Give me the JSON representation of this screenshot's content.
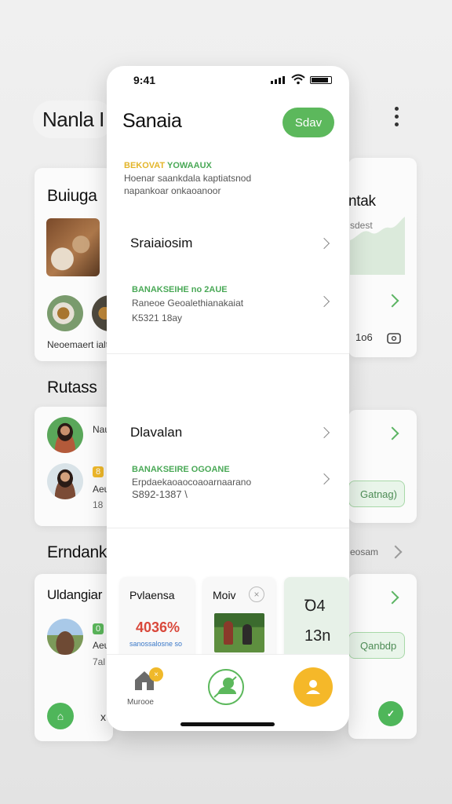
{
  "background": {
    "title": "Nanla I",
    "sections": {
      "s1": "Buiuga",
      "s2": "Rutass",
      "s3": "Erndankc",
      "card3_title": "Uldangiar"
    },
    "card1_caption": "Neoemaert ialt",
    "right_card1": {
      "title": "ntak",
      "sub": "sdest",
      "value": "1o6"
    },
    "card2_rows": [
      {
        "text": "Nau"
      },
      {
        "badge": "8",
        "text": "Aeu",
        "sub": "18"
      }
    ],
    "right_pill_1": "Gatnag)",
    "see_more": "eosam",
    "card3_badge": "0",
    "card3_text": "Aeu",
    "card3_sub": "7al",
    "right_pill_2": "Qanbdp"
  },
  "phone": {
    "status_time": "9:41",
    "title": "Sanaia",
    "action_button": "Sdav",
    "notice": {
      "tag_yellow": "BEKOVAT",
      "tag_green": "YOWAAUX",
      "line1": "Hoenar saankdala kaptiatsnod",
      "line2": "napankoar onkaoanoor"
    },
    "rows": [
      {
        "title": "Sraiaiosim"
      },
      {
        "tag": "BANAKSEIHE no 2AUE",
        "sub1": "Raneoe Geoalethianakaiat",
        "sub2": "K5321 18ay"
      },
      {
        "title": "Dlavalan"
      },
      {
        "tag": "BANAKSEIRE OGOANE",
        "sub1": "Erpdaekaoaocoaoarnaarano",
        "sub2": "S892-1387   \\"
      }
    ],
    "mini_cards": {
      "card1_title": "Pvlaensa",
      "card1_value": "4036%",
      "card1_sub": "sanossalosne so",
      "card2_title": "Moiv",
      "card3_value1": "Ꝺ4",
      "card3_value2": "13n"
    },
    "tabbar": {
      "home_label": "Murooe",
      "home_badge": "×"
    }
  }
}
